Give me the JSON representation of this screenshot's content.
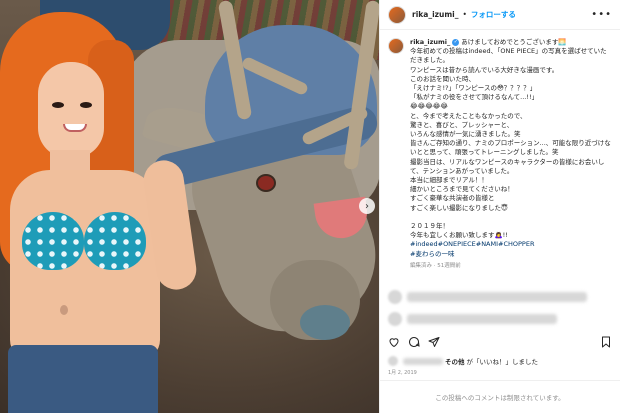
{
  "post": {
    "username": "rika_izumi_",
    "follow_label": "フォローする",
    "more_label": "•••",
    "dot": "•"
  },
  "caption": {
    "username": "rika_izumi_",
    "lines": [
      "あけましておめでとうございます🌅",
      "今年初めての投稿はindeed、「ONE PIECE」の写真を選ばせていただきました。",
      "ワンピースは昔から読んでいる大好きな漫画です。",
      "このお話を聞いた時、",
      "「えけナミ!?」「ワンピースの😳？？？？」",
      "「私がナミの役をさせて頂けるなんて...!!」",
      "😂😂😂😂😂",
      "と、今まで考えたこともなかったので、",
      "驚きと、喜びと、プレッシャーと、",
      "いろんな感情が一気に湧きました。笑",
      "皆さんご存知の通り、ナミのプロポーション...、可能な限り近づけないとと思って、頑張ってトレーニングしました。笑",
      "撮影当日は、リアルなワンピースのキャラクターの皆様にお会いして、テンションあがっていました。",
      "本当に細部までリアル！！",
      "細かいところまで見てくださいね！",
      "すごく豪華な共演者の皆様と",
      "すごく楽しい撮影になりました😇",
      "",
      "２０１９年！",
      "今年も宜しくお願い致します🙇‍♀️!!"
    ],
    "hashtags": [
      "#indeed#ONEPIECE#NAMI#CHOPPER",
      "#麦わらの一味"
    ],
    "edit_meta": "編集済み · 51週間前"
  },
  "likes": {
    "suffix": "その他",
    "middle": "が「いいね！」しました"
  },
  "date": "1月 2, 2019",
  "comments_disabled": "この投稿へのコメントは制限されています。",
  "icons": {
    "like": "heart-icon",
    "comment": "comment-icon",
    "share": "share-icon",
    "save": "bookmark-icon",
    "next": "chevron-right-icon",
    "verified": "verified-badge-icon"
  },
  "colors": {
    "link": "#0095f6",
    "hashtag": "#00376b",
    "muted": "#8e8e8e"
  }
}
